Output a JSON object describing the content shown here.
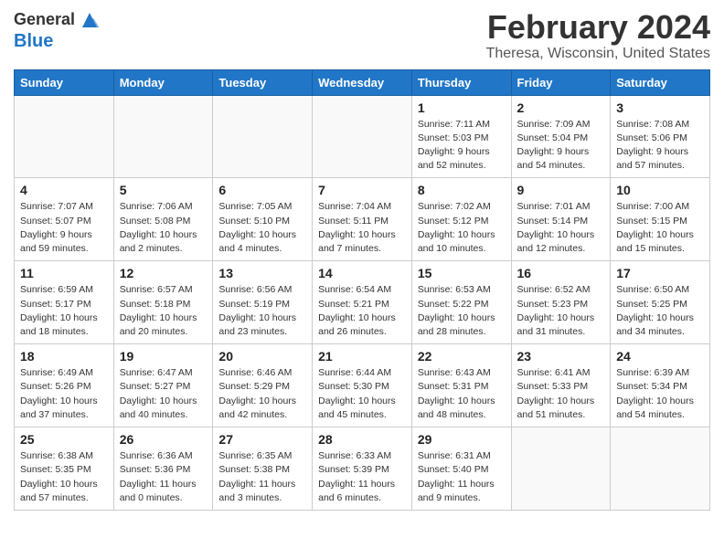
{
  "header": {
    "logo_line1": "General",
    "logo_line2": "Blue",
    "month": "February 2024",
    "location": "Theresa, Wisconsin, United States"
  },
  "weekdays": [
    "Sunday",
    "Monday",
    "Tuesday",
    "Wednesday",
    "Thursday",
    "Friday",
    "Saturday"
  ],
  "weeks": [
    [
      {
        "day": "",
        "info": ""
      },
      {
        "day": "",
        "info": ""
      },
      {
        "day": "",
        "info": ""
      },
      {
        "day": "",
        "info": ""
      },
      {
        "day": "1",
        "info": "Sunrise: 7:11 AM\nSunset: 5:03 PM\nDaylight: 9 hours\nand 52 minutes."
      },
      {
        "day": "2",
        "info": "Sunrise: 7:09 AM\nSunset: 5:04 PM\nDaylight: 9 hours\nand 54 minutes."
      },
      {
        "day": "3",
        "info": "Sunrise: 7:08 AM\nSunset: 5:06 PM\nDaylight: 9 hours\nand 57 minutes."
      }
    ],
    [
      {
        "day": "4",
        "info": "Sunrise: 7:07 AM\nSunset: 5:07 PM\nDaylight: 9 hours\nand 59 minutes."
      },
      {
        "day": "5",
        "info": "Sunrise: 7:06 AM\nSunset: 5:08 PM\nDaylight: 10 hours\nand 2 minutes."
      },
      {
        "day": "6",
        "info": "Sunrise: 7:05 AM\nSunset: 5:10 PM\nDaylight: 10 hours\nand 4 minutes."
      },
      {
        "day": "7",
        "info": "Sunrise: 7:04 AM\nSunset: 5:11 PM\nDaylight: 10 hours\nand 7 minutes."
      },
      {
        "day": "8",
        "info": "Sunrise: 7:02 AM\nSunset: 5:12 PM\nDaylight: 10 hours\nand 10 minutes."
      },
      {
        "day": "9",
        "info": "Sunrise: 7:01 AM\nSunset: 5:14 PM\nDaylight: 10 hours\nand 12 minutes."
      },
      {
        "day": "10",
        "info": "Sunrise: 7:00 AM\nSunset: 5:15 PM\nDaylight: 10 hours\nand 15 minutes."
      }
    ],
    [
      {
        "day": "11",
        "info": "Sunrise: 6:59 AM\nSunset: 5:17 PM\nDaylight: 10 hours\nand 18 minutes."
      },
      {
        "day": "12",
        "info": "Sunrise: 6:57 AM\nSunset: 5:18 PM\nDaylight: 10 hours\nand 20 minutes."
      },
      {
        "day": "13",
        "info": "Sunrise: 6:56 AM\nSunset: 5:19 PM\nDaylight: 10 hours\nand 23 minutes."
      },
      {
        "day": "14",
        "info": "Sunrise: 6:54 AM\nSunset: 5:21 PM\nDaylight: 10 hours\nand 26 minutes."
      },
      {
        "day": "15",
        "info": "Sunrise: 6:53 AM\nSunset: 5:22 PM\nDaylight: 10 hours\nand 28 minutes."
      },
      {
        "day": "16",
        "info": "Sunrise: 6:52 AM\nSunset: 5:23 PM\nDaylight: 10 hours\nand 31 minutes."
      },
      {
        "day": "17",
        "info": "Sunrise: 6:50 AM\nSunset: 5:25 PM\nDaylight: 10 hours\nand 34 minutes."
      }
    ],
    [
      {
        "day": "18",
        "info": "Sunrise: 6:49 AM\nSunset: 5:26 PM\nDaylight: 10 hours\nand 37 minutes."
      },
      {
        "day": "19",
        "info": "Sunrise: 6:47 AM\nSunset: 5:27 PM\nDaylight: 10 hours\nand 40 minutes."
      },
      {
        "day": "20",
        "info": "Sunrise: 6:46 AM\nSunset: 5:29 PM\nDaylight: 10 hours\nand 42 minutes."
      },
      {
        "day": "21",
        "info": "Sunrise: 6:44 AM\nSunset: 5:30 PM\nDaylight: 10 hours\nand 45 minutes."
      },
      {
        "day": "22",
        "info": "Sunrise: 6:43 AM\nSunset: 5:31 PM\nDaylight: 10 hours\nand 48 minutes."
      },
      {
        "day": "23",
        "info": "Sunrise: 6:41 AM\nSunset: 5:33 PM\nDaylight: 10 hours\nand 51 minutes."
      },
      {
        "day": "24",
        "info": "Sunrise: 6:39 AM\nSunset: 5:34 PM\nDaylight: 10 hours\nand 54 minutes."
      }
    ],
    [
      {
        "day": "25",
        "info": "Sunrise: 6:38 AM\nSunset: 5:35 PM\nDaylight: 10 hours\nand 57 minutes."
      },
      {
        "day": "26",
        "info": "Sunrise: 6:36 AM\nSunset: 5:36 PM\nDaylight: 11 hours\nand 0 minutes."
      },
      {
        "day": "27",
        "info": "Sunrise: 6:35 AM\nSunset: 5:38 PM\nDaylight: 11 hours\nand 3 minutes."
      },
      {
        "day": "28",
        "info": "Sunrise: 6:33 AM\nSunset: 5:39 PM\nDaylight: 11 hours\nand 6 minutes."
      },
      {
        "day": "29",
        "info": "Sunrise: 6:31 AM\nSunset: 5:40 PM\nDaylight: 11 hours\nand 9 minutes."
      },
      {
        "day": "",
        "info": ""
      },
      {
        "day": "",
        "info": ""
      }
    ]
  ]
}
